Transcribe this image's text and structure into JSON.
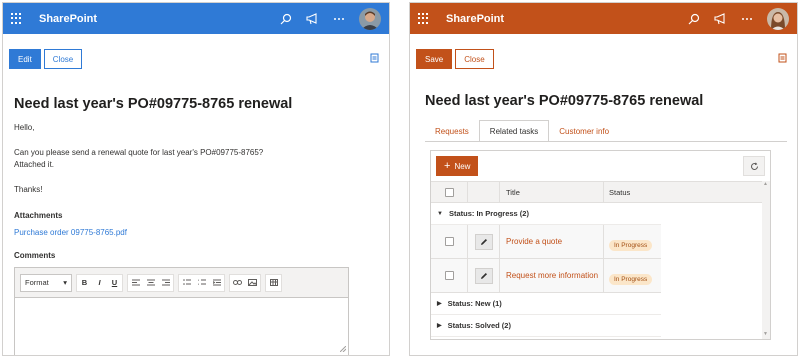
{
  "left": {
    "brand": "SharePoint",
    "commands": {
      "edit": "Edit",
      "close": "Close"
    },
    "title": "Need last year's PO#09775-8765 renewal",
    "body": {
      "greeting": "Hello,",
      "line1": "Can you please send a renewal quote for last year's PO#09775-8765?",
      "line2": "Attached it.",
      "signoff": "Thanks!"
    },
    "attachments_label": "Attachments",
    "attachment": "Purchase order 09775-8765.pdf",
    "comments_label": "Comments",
    "editor": {
      "format": "Format",
      "bold": "B",
      "italic": "I",
      "underline": "U"
    }
  },
  "right": {
    "brand": "SharePoint",
    "commands": {
      "save": "Save",
      "close": "Close"
    },
    "title": "Need last year's PO#09775-8765 renewal",
    "tabs": [
      {
        "label": "Requests",
        "active": false
      },
      {
        "label": "Related tasks",
        "active": true
      },
      {
        "label": "Customer info",
        "active": false
      }
    ],
    "subgrid": {
      "new_label": "New",
      "columns": {
        "title": "Title",
        "status": "Status"
      },
      "groups": [
        {
          "label": "Status: In Progress (2)",
          "expanded": true
        },
        {
          "label": "Status: New (1)",
          "expanded": false
        },
        {
          "label": "Status: Solved (2)",
          "expanded": false
        }
      ],
      "rows": [
        {
          "title": "Provide a quote",
          "status": "In Progress"
        },
        {
          "title": "Request more information",
          "status": "In Progress"
        }
      ]
    }
  },
  "colors": {
    "blue_theme": "#2f7ad6",
    "orange_theme": "#c2511a",
    "pill_bg": "#fbe6c9"
  },
  "icons": [
    "waffle-icon",
    "search-icon",
    "megaphone-icon",
    "more-icon",
    "avatar",
    "document-icon",
    "plus-icon",
    "refresh-icon",
    "pencil-icon"
  ]
}
